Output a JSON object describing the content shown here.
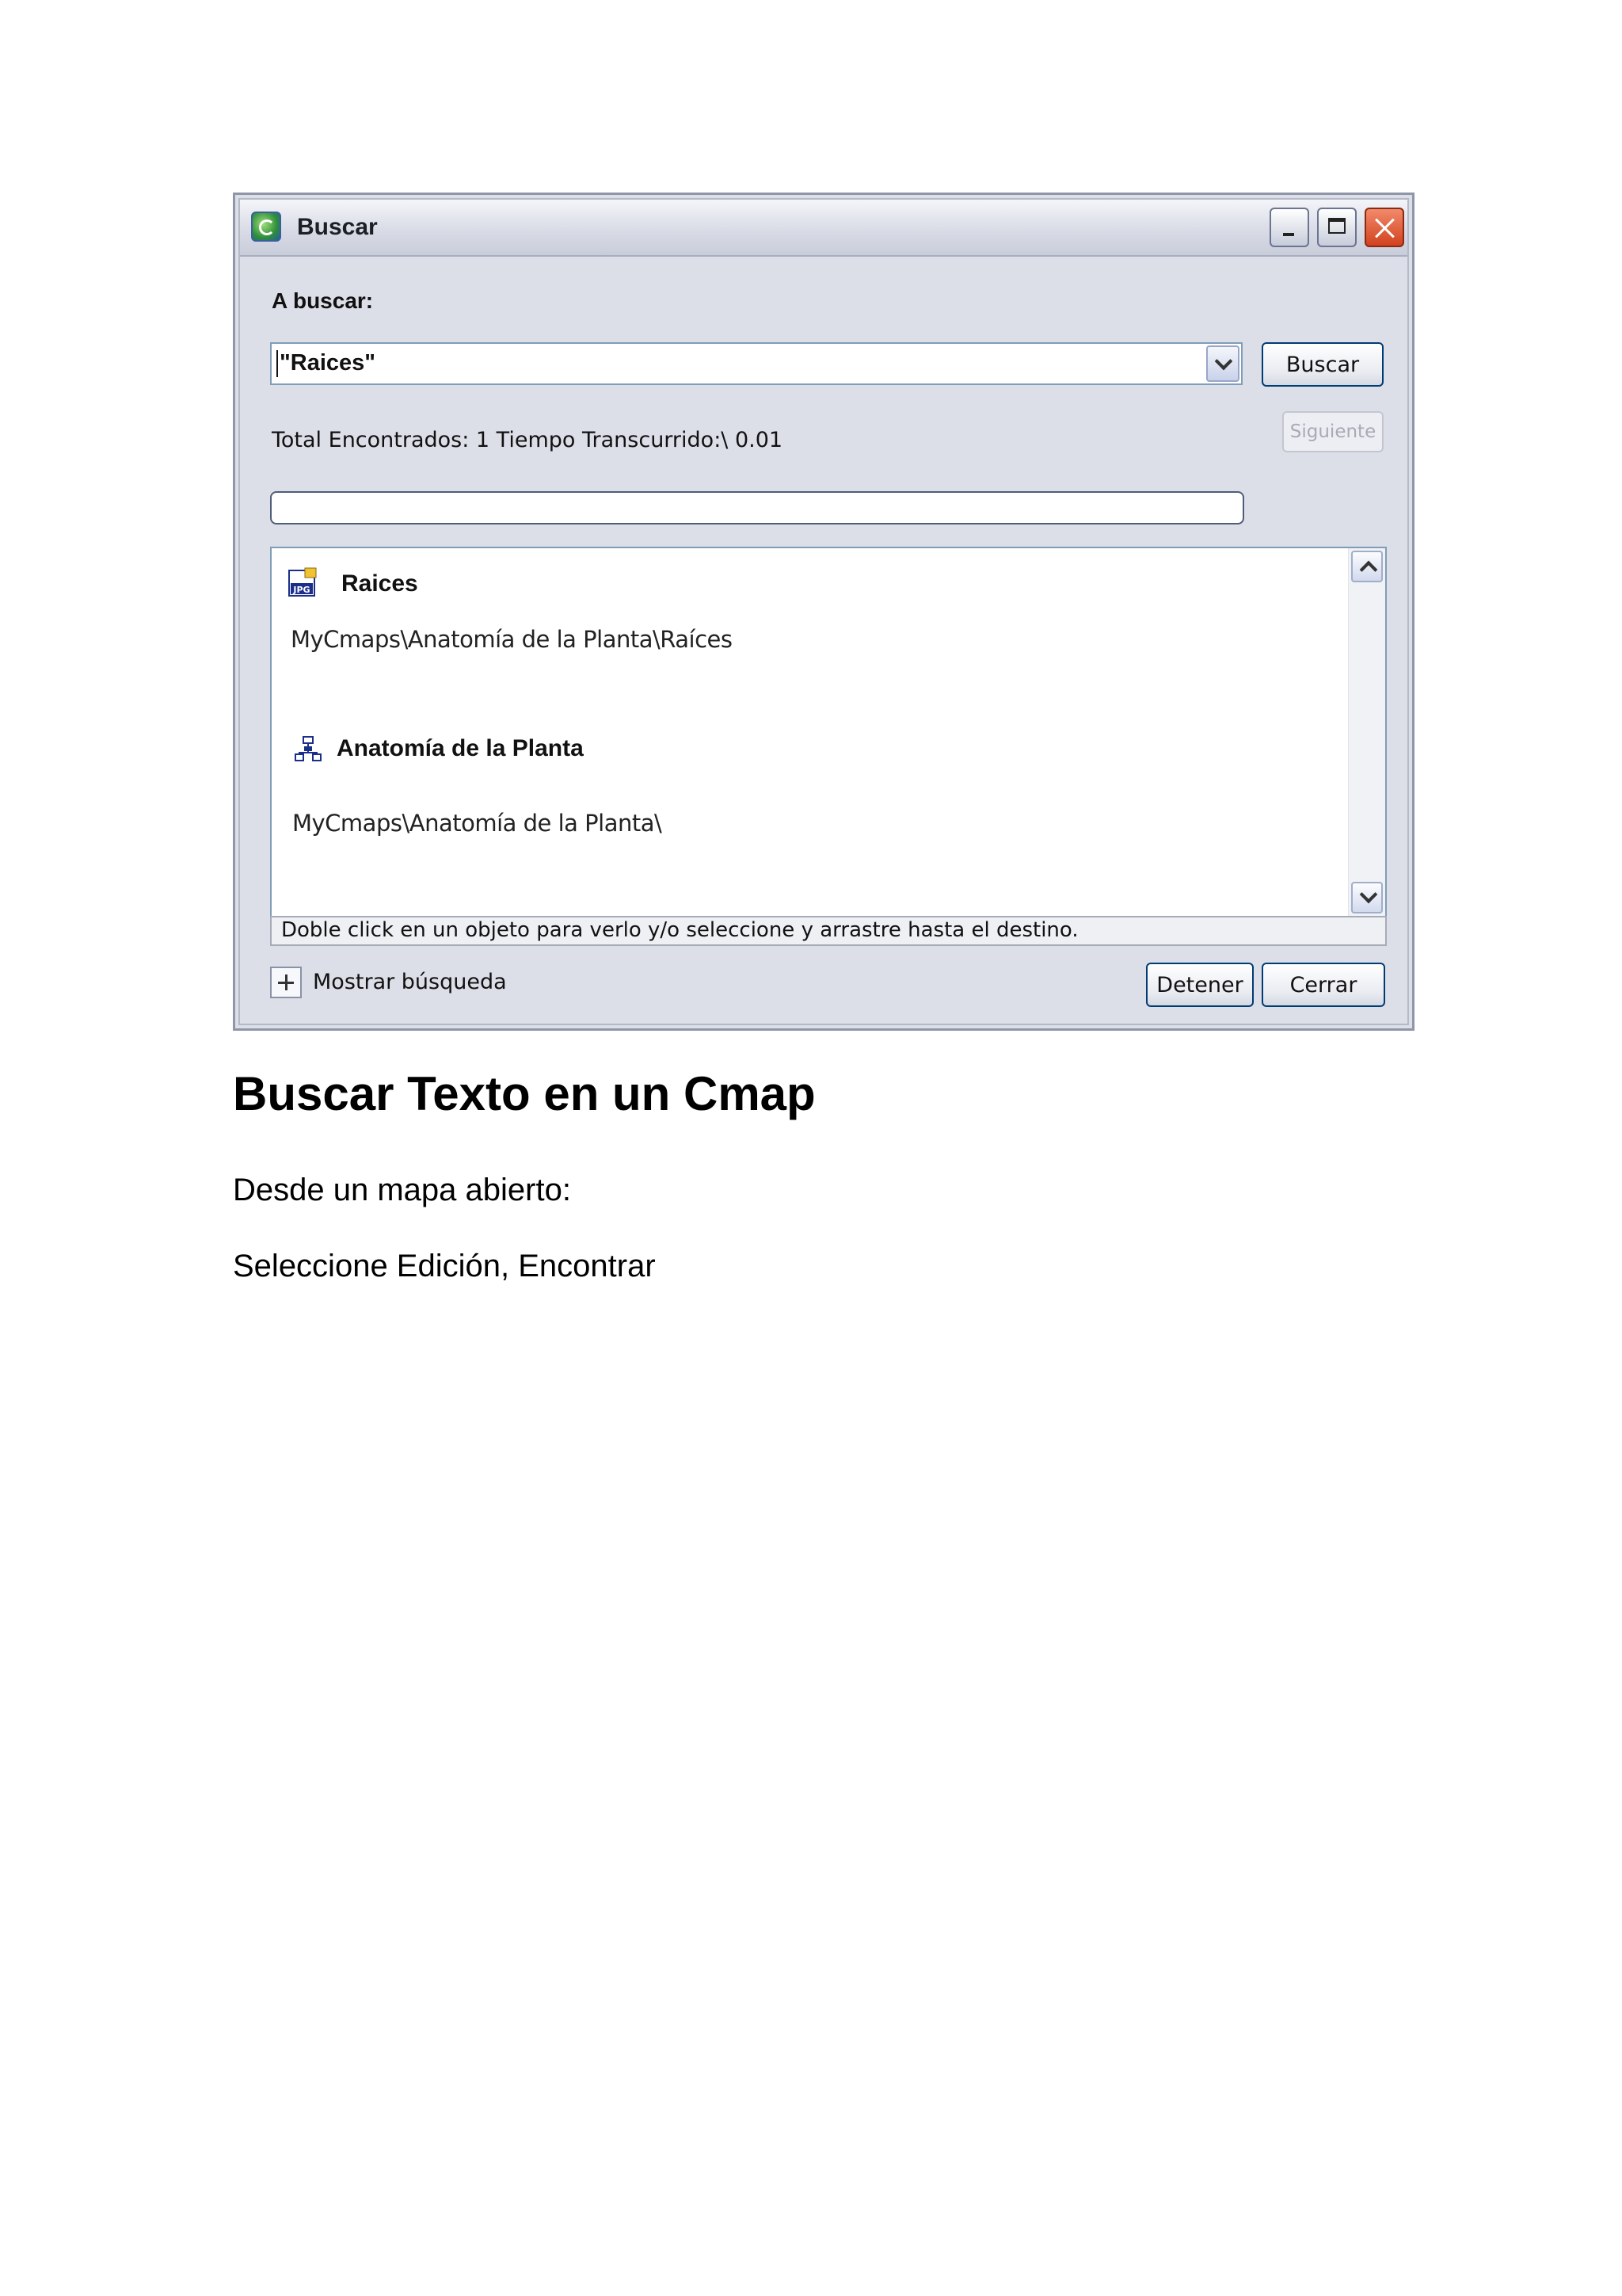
{
  "window": {
    "title": "Buscar",
    "search_label": "A buscar:",
    "search_value": "\"Raices\"",
    "search_button": "Buscar",
    "next_button": "Siguiente",
    "status_text": "Total Encontrados:  1  Tiempo Transcurrido:\\ 0.01",
    "progress": 0,
    "results": [
      {
        "title": "Raices",
        "icon": "jpg-image-icon",
        "path": "MyCmaps\\Anatomía de la Planta\\Raíces"
      },
      {
        "title": "Anatomía de la Planta",
        "icon": "cmap-icon",
        "path": "MyCmaps\\Anatomía de la Planta\\"
      }
    ],
    "hint_text": "Doble click en un objeto para verlo y/o seleccione y arrastre hasta el destino.",
    "show_search_label": "Mostrar búsqueda",
    "stop_button": "Detener",
    "close_button": "Cerrar"
  },
  "document": {
    "heading": "Buscar Texto en un Cmap",
    "paragraph1": "Desde un mapa abierto:",
    "paragraph2": "Seleccione Edición, Encontrar"
  }
}
